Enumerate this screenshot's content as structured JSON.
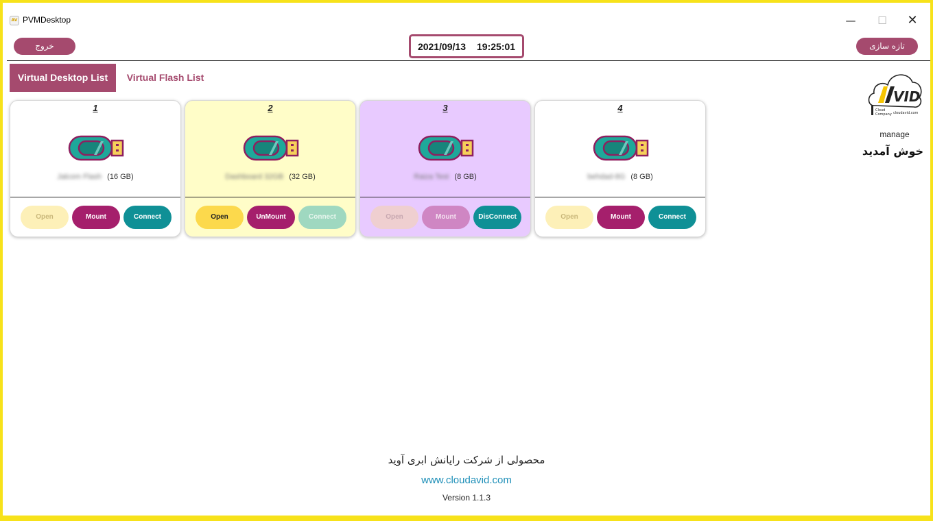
{
  "window": {
    "title": "PVMDesktop"
  },
  "header": {
    "exit_label": "خروج",
    "refresh_label": "تازه سازی",
    "date": "2021/09/13",
    "time": "19:25:01"
  },
  "tabs": [
    {
      "label": "Virtual Desktop List",
      "active": true
    },
    {
      "label": "Virtual Flash List",
      "active": false
    }
  ],
  "side": {
    "logo_text": "AVID",
    "manage_label": "manage",
    "welcome": "خوش آمدید"
  },
  "cards": [
    {
      "number": "1",
      "name": "Jalcom Flash",
      "size": "(16 GB)",
      "bg": "#ffffff",
      "buttons": [
        {
          "label": "Open",
          "bg": "#fdf0b8",
          "fg": "#c9b77a"
        },
        {
          "label": "Mount",
          "bg": "#a51f6c",
          "fg": "#ffffff"
        },
        {
          "label": "Connect",
          "bg": "#0f9096",
          "fg": "#ffffff"
        }
      ]
    },
    {
      "number": "2",
      "name": "Dashboard 32GB",
      "size": "(32 GB)",
      "bg": "#fffdc8",
      "buttons": [
        {
          "label": "Open",
          "bg": "#fcd94c",
          "fg": "#222222"
        },
        {
          "label": "UnMount",
          "bg": "#a51f6c",
          "fg": "#ffffff"
        },
        {
          "label": "Connect",
          "bg": "#9fd8c0",
          "fg": "#e8f6ee"
        }
      ]
    },
    {
      "number": "3",
      "name": "Raiza Test",
      "size": "(8 GB)",
      "bg": "#e8caff",
      "buttons": [
        {
          "label": "Open",
          "bg": "#efcfd0",
          "fg": "#c7a7b0"
        },
        {
          "label": "Mount",
          "bg": "#cf86c3",
          "fg": "#f4e2f0"
        },
        {
          "label": "DisConnect",
          "bg": "#0f9096",
          "fg": "#ffffff"
        }
      ]
    },
    {
      "number": "4",
      "name": "behdad-8G",
      "size": "(8 GB)",
      "bg": "#ffffff",
      "buttons": [
        {
          "label": "Open",
          "bg": "#fdf0b8",
          "fg": "#c9b77a"
        },
        {
          "label": "Mount",
          "bg": "#a51f6c",
          "fg": "#ffffff"
        },
        {
          "label": "Connect",
          "bg": "#0f9096",
          "fg": "#ffffff"
        }
      ]
    }
  ],
  "footer": {
    "company": "محصولی از شرکت رایانش ابری آوید",
    "url": "www.cloudavid.com",
    "version": "Version 1.1.3"
  },
  "colors": {
    "accent": "#a54a6e",
    "teal": "#0f9096",
    "magenta": "#a51f6c",
    "frame": "#f7e21a"
  }
}
